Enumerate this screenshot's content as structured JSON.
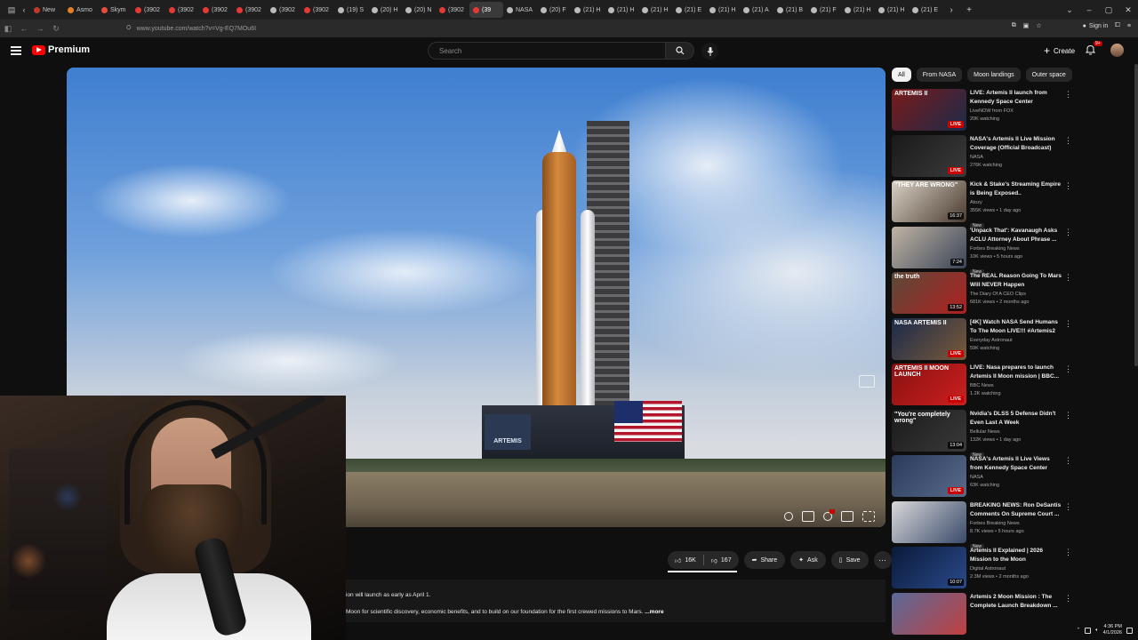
{
  "browser": {
    "tabs": [
      {
        "label": "New",
        "color": "#c0392b",
        "active": false
      },
      {
        "label": "Asmo",
        "color": "#e67e22",
        "active": false
      },
      {
        "label": "Skym",
        "color": "#e74c3c",
        "active": false
      },
      {
        "label": "(3902",
        "color": "#e53935",
        "active": false
      },
      {
        "label": "(3902",
        "color": "#e53935",
        "active": false
      },
      {
        "label": "(3902",
        "color": "#e53935",
        "active": false
      },
      {
        "label": "(3902",
        "color": "#e53935",
        "active": false
      },
      {
        "label": "(3902",
        "color": "#bbbbbb",
        "active": false
      },
      {
        "label": "(3902",
        "color": "#e53935",
        "active": false
      },
      {
        "label": "(19) S",
        "color": "#bbbbbb",
        "active": false
      },
      {
        "label": "(20) H",
        "color": "#bbbbbb",
        "active": false
      },
      {
        "label": "(20) N",
        "color": "#bbbbbb",
        "active": false
      },
      {
        "label": "(3902",
        "color": "#e53935",
        "active": false
      },
      {
        "label": "(39",
        "color": "#e53935",
        "active": true
      },
      {
        "label": "NASA",
        "color": "#bbbbbb",
        "active": false
      },
      {
        "label": "(20) F",
        "color": "#bbbbbb",
        "active": false
      },
      {
        "label": "(21) H",
        "color": "#bbbbbb",
        "active": false
      },
      {
        "label": "(21) H",
        "color": "#bbbbbb",
        "active": false
      },
      {
        "label": "(21) H",
        "color": "#bbbbbb",
        "active": false
      },
      {
        "label": "(21) E",
        "color": "#bbbbbb",
        "active": false
      },
      {
        "label": "(21) H",
        "color": "#bbbbbb",
        "active": false
      },
      {
        "label": "(21) A",
        "color": "#bbbbbb",
        "active": false
      },
      {
        "label": "(21) B",
        "color": "#bbbbbb",
        "active": false
      },
      {
        "label": "(21) F",
        "color": "#bbbbbb",
        "active": false
      },
      {
        "label": "(21) H",
        "color": "#bbbbbb",
        "active": false
      },
      {
        "label": "(21) H",
        "color": "#bbbbbb",
        "active": false
      },
      {
        "label": "(21) E",
        "color": "#bbbbbb",
        "active": false
      }
    ],
    "url": "www.youtube.com/watch?v=Vg-EQ7MOu6I",
    "signin_label": "Sign in"
  },
  "header": {
    "logo_text": "Premium",
    "search_placeholder": "Search",
    "create_label": "Create",
    "notification_count": "9+"
  },
  "player": {
    "platform_label": "ARTEMIS"
  },
  "actions": {
    "likes": "16K",
    "dislikes": "167",
    "share": "Share",
    "ask": "Ask",
    "save": "Save"
  },
  "description": {
    "line1": "ion will launch as early as April 1.",
    "line2": "Moon for scientific discovery, economic benefits, and to build on our foundation for the first crewed missions to Mars.",
    "more": "...more"
  },
  "chips": [
    "All",
    "From NASA",
    "Moon landings",
    "Outer space"
  ],
  "recommendations": [
    {
      "title": "LIVE: Artemis II launch from Kennedy Space Center",
      "channel": "LiveNOW from FOX",
      "meta": "20K watching",
      "badge": "LIVE",
      "thumb_text": "ARTEMIS II",
      "thumb_colors": [
        "#7a1a1a",
        "#1c2b4a"
      ],
      "is_new": false
    },
    {
      "title": "NASA's Artemis II Live Mission Coverage (Official Broadcast)",
      "channel": "NASA",
      "meta": "276K watching",
      "badge": "LIVE",
      "thumb_text": "",
      "thumb_colors": [
        "#1a1a1a",
        "#3a3a3a"
      ],
      "is_new": false
    },
    {
      "title": "Kick & Stake's Streaming Empire is Being Exposed..",
      "channel": "Atozy",
      "meta": "355K views • 1 day ago",
      "badge": "16:37",
      "thumb_text": "\"THEY ARE WRONG\"",
      "thumb_colors": [
        "#d9d2c5",
        "#4a3a30"
      ],
      "is_new": true
    },
    {
      "title": "'Unpack That': Kavanaugh Asks ACLU Attorney About Phrase ...",
      "channel": "Forbes Breaking News",
      "meta": "10K views • 5 hours ago",
      "badge": "7:24",
      "thumb_text": "",
      "thumb_colors": [
        "#c0b4a6",
        "#3a4556"
      ],
      "is_new": true
    },
    {
      "title": "The REAL Reason Going To Mars Will NEVER Happen",
      "channel": "The Diary Of A CEO Clips",
      "meta": "681K views • 2 months ago",
      "badge": "13:52",
      "thumb_text": "the truth",
      "thumb_colors": [
        "#5a4a3a",
        "#b02020"
      ],
      "is_new": false
    },
    {
      "title": "[4K] Watch NASA Send Humans To The Moon LIVE!!! #Artemis2",
      "channel": "Everyday Astronaut",
      "meta": "59K watching",
      "badge": "LIVE",
      "thumb_text": "NASA ARTEMIS II",
      "thumb_colors": [
        "#1a2a4a",
        "#7a5a3a"
      ],
      "is_new": false
    },
    {
      "title": "LIVE: Nasa prepares to launch Artemis II Moon mission | BBC...",
      "channel": "BBC News",
      "meta": "1.2K watching",
      "badge": "LIVE",
      "thumb_text": "ARTEMIS II MOON LAUNCH",
      "thumb_colors": [
        "#8a1010",
        "#cc2020"
      ],
      "is_new": false
    },
    {
      "title": "Nvidia's DLSS 5 Defense Didn't Even Last A Week",
      "channel": "Bellular News",
      "meta": "132K views • 1 day ago",
      "badge": "13:04",
      "thumb_text": "\"You're completely wrong\"",
      "thumb_colors": [
        "#1a1a1a",
        "#3a3a3a"
      ],
      "is_new": true
    },
    {
      "title": "NASA's Artemis II Live Views from Kennedy Space Center",
      "channel": "NASA",
      "meta": "63K watching",
      "badge": "LIVE",
      "thumb_text": "",
      "thumb_colors": [
        "#2a3a5a",
        "#5a6a8a"
      ],
      "is_new": false
    },
    {
      "title": "BREAKING NEWS: Ron DeSantis Comments On Supreme Court ...",
      "channel": "Forbes Breaking News",
      "meta": "8.7K views • 5 hours ago",
      "badge": "",
      "thumb_text": "",
      "thumb_colors": [
        "#d8d8d8",
        "#3a4a6a"
      ],
      "is_new": true
    },
    {
      "title": "Artemis II Explained | 2026 Mission to the Moon",
      "channel": "Digital Astronaut",
      "meta": "2.3M views • 2 months ago",
      "badge": "10:07",
      "thumb_text": "",
      "thumb_colors": [
        "#0a1a3a",
        "#2a4a8a"
      ],
      "is_new": false
    },
    {
      "title": "Artemis 2 Moon Mission : The Complete Launch Breakdown ...",
      "channel": "",
      "meta": "",
      "badge": "",
      "thumb_text": "",
      "thumb_colors": [
        "#5a6a9a",
        "#c04040"
      ],
      "is_new": false
    }
  ],
  "taskbar": {
    "time": "4:36 PM",
    "date": "4/1/2026"
  }
}
